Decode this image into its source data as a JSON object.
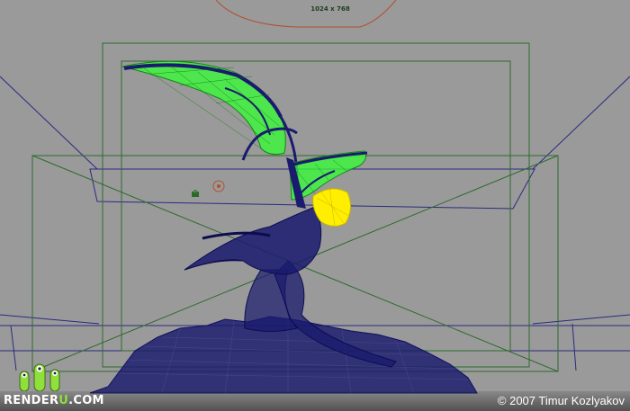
{
  "viewport": {
    "resolution_label": "1024 x 768",
    "colors": {
      "background": "#9a9a9a",
      "wireframe": "#1a1a6e",
      "selected": "#33ff33",
      "highlight": "#ffee00",
      "resolution_gate": "#2e6b2e",
      "camera_lines": "#2a2a80"
    }
  },
  "footer": {
    "logo_left": "RENDER",
    "logo_accent": "U",
    "logo_right": ".COM",
    "copyright": "© 2007 Timur Kozlyakov"
  },
  "icons": {
    "camera": "camera-icon",
    "light": "light-icon",
    "mascot": "alien-mascot-icon"
  }
}
